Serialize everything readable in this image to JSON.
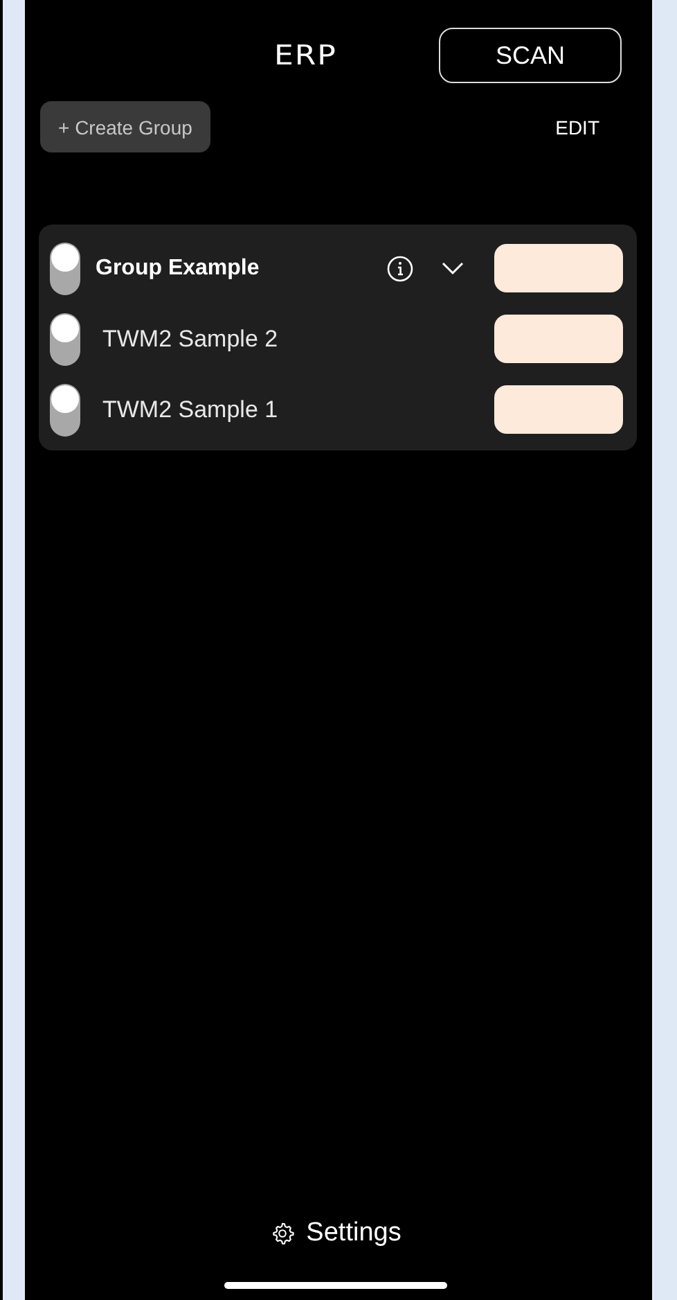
{
  "header": {
    "logo": "ERP",
    "scan_button": "SCAN"
  },
  "toolbar": {
    "create_group_button": "+ Create Group",
    "edit_button": "EDIT"
  },
  "group": {
    "name": "Group Example",
    "on": false,
    "expanded": true,
    "devices": [
      {
        "name": "TWM2 Sample 2",
        "on": false
      },
      {
        "name": "TWM2 Sample 1",
        "on": false
      }
    ]
  },
  "footer": {
    "settings_label": "Settings"
  }
}
